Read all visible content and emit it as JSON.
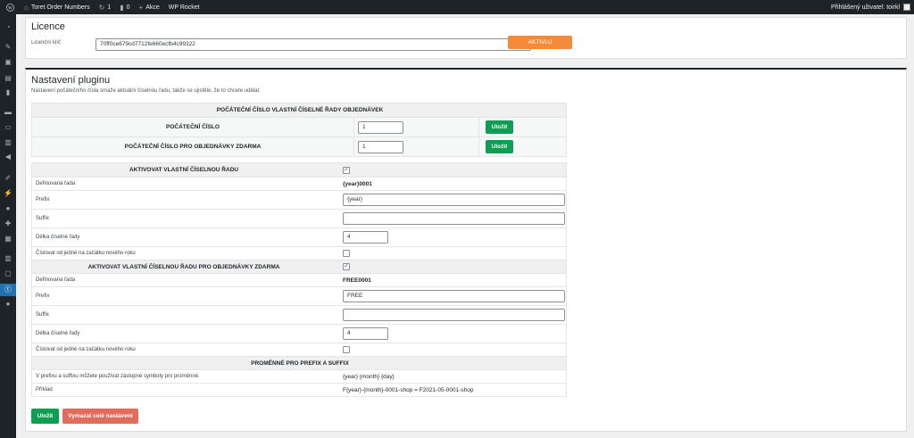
{
  "adminbar": {
    "site_name": "Toret Order Numbers",
    "updates_count": "1",
    "comments_count": "0",
    "new_label": "Akce",
    "rocket_label": "WP Rocket",
    "user_label": "Přihlášený uživatel: toirkl"
  },
  "licence": {
    "title": "Licence",
    "key_label": "Licenční klíč",
    "key_value": "70ff0ce679cd7712fe660ecfb4c99322",
    "activate_label": "AKTIVUJ"
  },
  "settings": {
    "title": "Nastavení pluginu",
    "description": "Nastavení počátečního čísla smaže aktuální číselnou řadu, takže se ujistěte, že to chcete udělat.",
    "start_table": {
      "heading": "POČÁTEČNÍ ČÍSLO VLASTNÍ ČÍSELNÉ ŘADY OBJEDNÁVEK",
      "start_label": "POČÁTEČNÍ ČÍSLO",
      "start_value": "1",
      "start_free_label": "POČÁTEČNÍ ČÍSLO PRO OBJEDNÁVKY ZDARMA",
      "start_free_value": "1",
      "save_label": "Uložit"
    },
    "series": {
      "activate_label": "AKTIVOVAT VLASTNÍ ČÍSELNOU ŘADU",
      "activate_checked": "✓",
      "defined_label": "Definovaná řada",
      "defined_value": "{year}0001",
      "prefix_label": "Prefix",
      "prefix_value": "{year}",
      "suffix_label": "Suffix",
      "suffix_value": "",
      "length_label": "Délka číselné řady",
      "length_value": "4",
      "reset_label": "Číslovat od jedné na začátku nového roku"
    },
    "series_free": {
      "activate_label": "AKTIVOVAT VLASTNÍ ČÍSELNOU ŘADU PRO OBJEDNÁVKY ZDARMA",
      "activate_checked": "✓",
      "defined_label": "Definovaná řada",
      "defined_value": "FREE0001",
      "prefix_label": "Prefix",
      "prefix_value": "FREE",
      "suffix_label": "Suffix",
      "suffix_value": "",
      "length_label": "Délka číselné řady",
      "length_value": "4",
      "reset_label": "Číslovat od jedné na začátku nového roku"
    },
    "variables": {
      "heading": "PROMĚNNÉ PRO PREFIX A SUFFIX",
      "info_label": "V prefixu a suffixu můžete používat zástupné symboly pro proměnné.",
      "info_value": "{year} {month} {day}",
      "example_label": "Příklad",
      "example_value": "F{year}-{month}-0001-shop = F2021-05-0001-shop"
    },
    "save_label": "Uložit",
    "delete_label": "Vymazat celé nastavení"
  },
  "icons": {
    "wp_logo": "wordpress-icon",
    "home": "home-icon",
    "updates": "updates-icon",
    "comments": "comments-icon",
    "plus": "plus-icon"
  }
}
